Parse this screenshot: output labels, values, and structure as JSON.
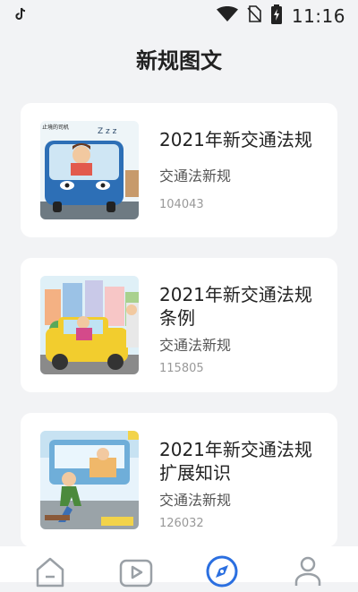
{
  "status_bar": {
    "left_icon": "tiktok-icon",
    "time": "11:16",
    "right_icons": [
      "wifi-icon",
      "no-sim-icon",
      "battery-charging-icon"
    ]
  },
  "page": {
    "title": "新规图文"
  },
  "cards": [
    {
      "title": "2021年新交通法规",
      "subtitle": "交通法新规",
      "count": "104043",
      "thumb_caption": "止境的司机"
    },
    {
      "title": "2021年新交通法规条例",
      "subtitle": "交通法新规",
      "count": "115805"
    },
    {
      "title": "2021年新交通法规扩展知识",
      "subtitle": "交通法新规",
      "count": "126032"
    }
  ],
  "nav": {
    "items": [
      "home-icon",
      "video-icon",
      "compass-icon",
      "profile-icon"
    ],
    "active_index": 2,
    "active_color": "#2b6fe0",
    "inactive_color": "#9aa0a6"
  }
}
